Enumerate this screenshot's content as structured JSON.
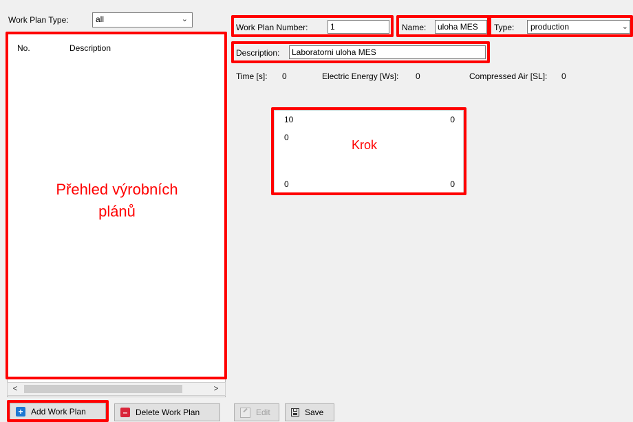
{
  "filter": {
    "label": "Work Plan Type:",
    "value": "all",
    "chevron_icon": "chevron-down-icon"
  },
  "list": {
    "columns": [
      "No.",
      "Description"
    ],
    "overlay_line1": "Přehled výrobních",
    "overlay_line2": "plánů",
    "scroll_left": "<",
    "scroll_right": ">"
  },
  "plan": {
    "number_label": "Work Plan Number:",
    "number_value": "1",
    "name_label": "Name:",
    "name_value": "uloha MES",
    "type_label": "Type:",
    "type_value": "production",
    "description_label": "Description:",
    "description_value": "Laboratorni uloha MES"
  },
  "stats": {
    "time_label": "Time [s]:",
    "time_value": "0",
    "energy_label": "Electric Energy [Ws]:",
    "energy_value": "0",
    "air_label": "Compressed Air [SL]:",
    "air_value": "0"
  },
  "step": {
    "top_left": "10",
    "top_right": "0",
    "second_left": "0",
    "bottom_left": "0",
    "bottom_right": "0",
    "label": "Krok"
  },
  "buttons": {
    "add": "Add Work Plan",
    "delete": "Delete Work Plan",
    "edit": "Edit",
    "save": "Save"
  },
  "colors": {
    "annotation": "#ff0000",
    "add_icon": "#1e78d2",
    "delete_icon": "#d9263a"
  }
}
